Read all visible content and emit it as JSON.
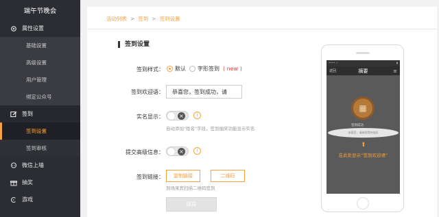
{
  "sidebar": {
    "title": "端午节晚会",
    "groups": [
      {
        "label": "属性设置",
        "icon": "gear-icon"
      },
      {
        "label": "签到",
        "icon": "edit-icon"
      },
      {
        "label": "微信上墙",
        "icon": "chat-icon"
      },
      {
        "label": "抽奖",
        "icon": "gift-icon"
      },
      {
        "label": "游戏",
        "icon": "game-icon"
      }
    ],
    "attr_items": [
      "基础设置",
      "高级设置",
      "用户管理",
      "绑定公众号"
    ],
    "signin_items": [
      "签到设置",
      "签到审核"
    ]
  },
  "breadcrumb": {
    "items": [
      "活动列表",
      "签到",
      "签到设置"
    ],
    "sep": ">"
  },
  "section_title": "签到设置",
  "form": {
    "style": {
      "label": "签到样式：",
      "opt_default": "默认",
      "opt_text": "字形签到",
      "new_tag": "( new )"
    },
    "welcome": {
      "label": "签到欢迎语：",
      "value": "恭喜您，签到成功，请"
    },
    "realname": {
      "label": "实名显示：",
      "hint": "自动添加\"姓名\"字段，签到抽奖功能显示实名"
    },
    "advanced": {
      "label": "提交高级信息："
    },
    "link": {
      "label": "签到链接：",
      "copy_btn": "复制链接",
      "qr_btn": "二维码",
      "hint": "到场来宾扫描二维码签到"
    },
    "save_label": "保存"
  },
  "phone": {
    "title": "摘要",
    "back": "返回",
    "welcome_label": "签到成功",
    "welcome_bubble": "恭喜您，请继续等待抽奖",
    "hint": "在此处显示“签到欢迎语”"
  },
  "colors": {
    "accent": "#f7a240",
    "sidebar_bg": "#2b2d33"
  }
}
